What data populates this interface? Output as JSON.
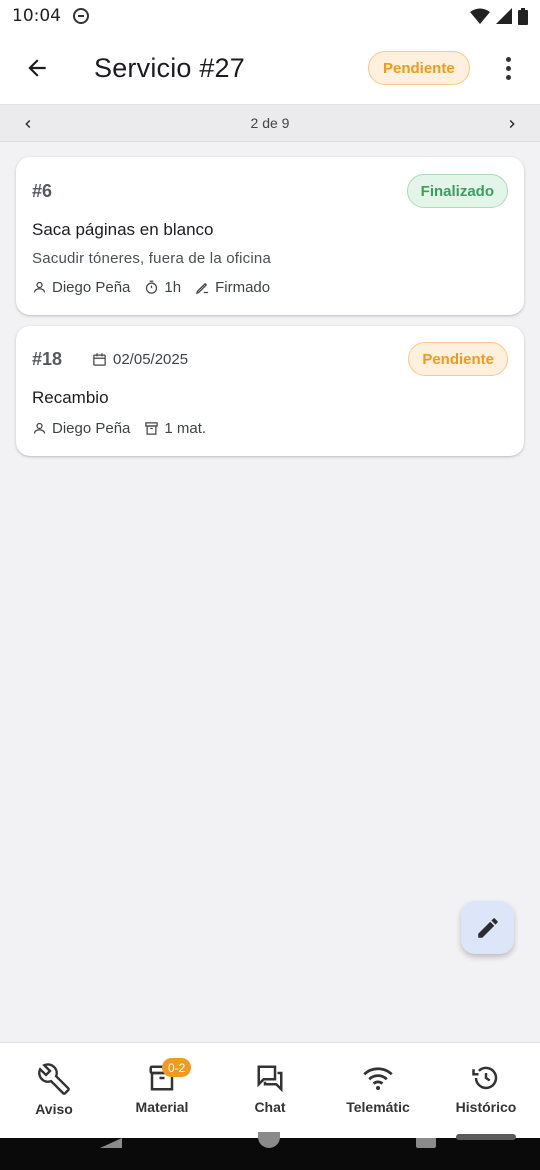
{
  "status_bar": {
    "time": "10:04"
  },
  "app_bar": {
    "back_icon": "arrow-back-icon",
    "title": "Servicio #27",
    "status_chip": "Pendiente",
    "more_icon": "more-vertical-icon"
  },
  "pager": {
    "text": "2 de 9"
  },
  "cards": [
    {
      "number": "#6",
      "badge": "Finalizado",
      "title": "Saca páginas en blanco",
      "subtitle": "Sacudir tóneres, fuera de la oficina",
      "technician": "Diego Peña",
      "duration": "1h",
      "signature": "Firmado"
    },
    {
      "number": "#18",
      "date": "02/05/2025",
      "badge": "Pendiente",
      "title": "Recambio",
      "technician": "Diego Peña",
      "materials": "1 mat."
    }
  ],
  "fab": {
    "icon": "edit-pencil-icon"
  },
  "bottom_nav": [
    {
      "label": "Aviso",
      "icon": "wrench-icon"
    },
    {
      "label": "Material",
      "icon": "archive-box-icon",
      "badge": "0-2"
    },
    {
      "label": "Chat",
      "icon": "chat-icon"
    },
    {
      "label": "Telemátic",
      "icon": "wifi-icon"
    },
    {
      "label": "Histórico",
      "icon": "history-icon"
    }
  ],
  "colors": {
    "pending": "#ef9a1b",
    "finished": "#3a9f5c",
    "fab_bg": "#dde6f8",
    "badge": "#f19a1f"
  }
}
